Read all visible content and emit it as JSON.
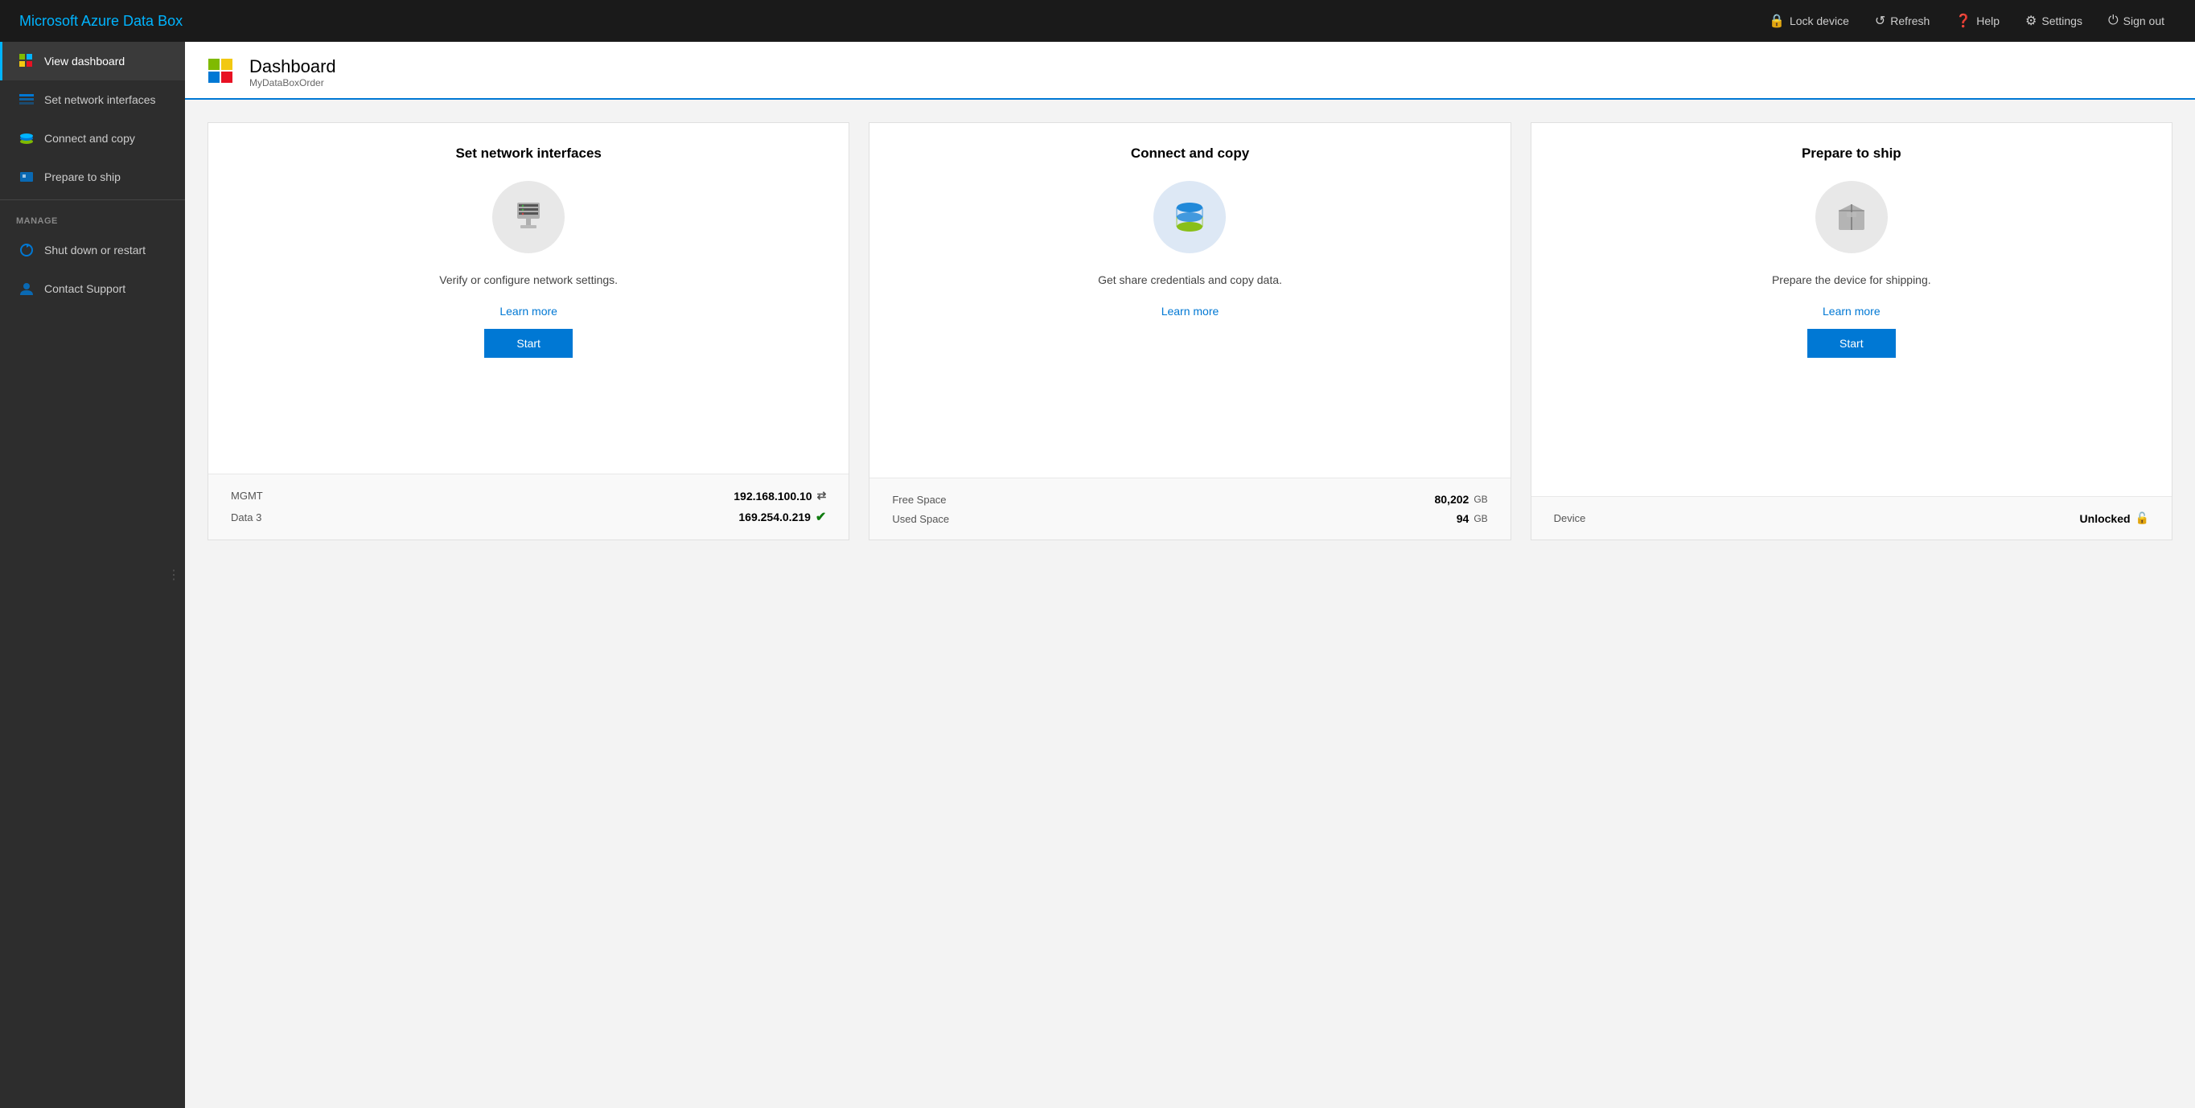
{
  "app": {
    "title": "Microsoft Azure Data Box"
  },
  "topbar": {
    "lock_label": "Lock device",
    "refresh_label": "Refresh",
    "help_label": "Help",
    "settings_label": "Settings",
    "signout_label": "Sign out"
  },
  "sidebar": {
    "items": [
      {
        "id": "view-dashboard",
        "label": "View dashboard",
        "active": true
      },
      {
        "id": "set-network-interfaces",
        "label": "Set network interfaces",
        "active": false
      },
      {
        "id": "connect-and-copy",
        "label": "Connect and copy",
        "active": false
      },
      {
        "id": "prepare-to-ship",
        "label": "Prepare to ship",
        "active": false
      }
    ],
    "manage_label": "MANAGE",
    "manage_items": [
      {
        "id": "shut-down-or-restart",
        "label": "Shut down or restart"
      },
      {
        "id": "contact-support",
        "label": "Contact Support"
      }
    ]
  },
  "page": {
    "title": "Dashboard",
    "subtitle": "MyDataBoxOrder"
  },
  "cards": [
    {
      "id": "set-network-interfaces",
      "title": "Set network interfaces",
      "description": "Verify or configure network settings.",
      "learn_more": "Learn more",
      "start_label": "Start",
      "stats": [
        {
          "label": "MGMT",
          "value": "192.168.100.10",
          "suffix": "",
          "icon": "arrows"
        },
        {
          "label": "Data 3",
          "value": "169.254.0.219",
          "suffix": "",
          "icon": "check"
        }
      ]
    },
    {
      "id": "connect-and-copy",
      "title": "Connect and copy",
      "description": "Get share credentials and copy data.",
      "learn_more": "Learn more",
      "start_label": null,
      "stats": [
        {
          "label": "Free Space",
          "value": "80,202",
          "suffix": "GB",
          "icon": null
        },
        {
          "label": "Used Space",
          "value": "94",
          "suffix": "GB",
          "icon": null
        }
      ]
    },
    {
      "id": "prepare-to-ship",
      "title": "Prepare to ship",
      "description": "Prepare the device for shipping.",
      "learn_more": "Learn more",
      "start_label": "Start",
      "stats": [
        {
          "label": "Device",
          "value": "Unlocked",
          "suffix": "",
          "icon": "unlock"
        }
      ]
    }
  ]
}
